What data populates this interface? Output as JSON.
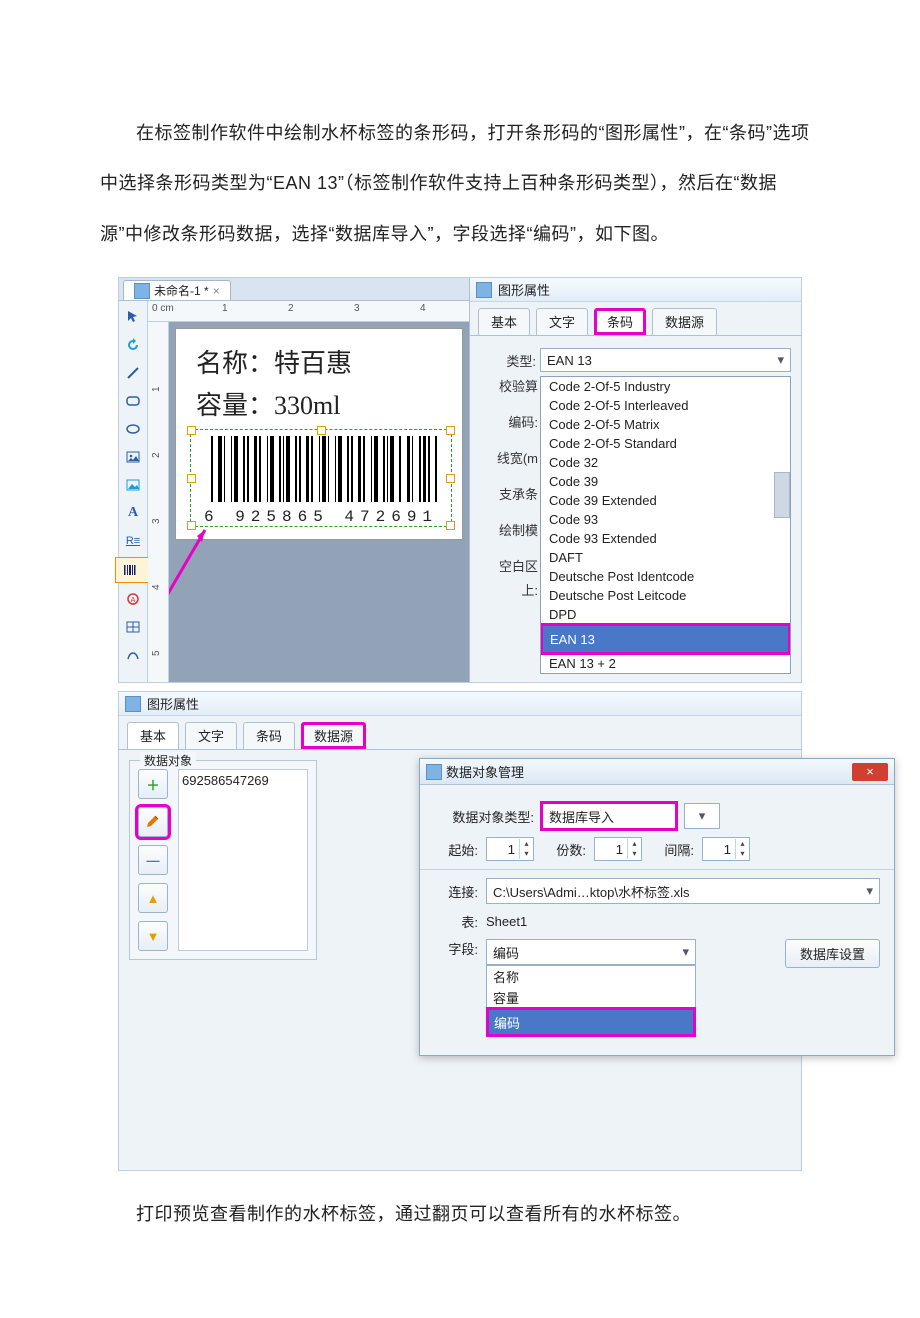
{
  "doc": {
    "para1": "在标签制作软件中绘制水杯标签的条形码，打开条形码的“图形属性”，在“条码”选项中选择条形码类型为“EAN 13”（标签制作软件支持上百种条形码类型），然后在“数据源”中修改条形码数据，选择“数据库导入”，字段选择“编码”，如下图。",
    "para2": "打印预览查看制作的水杯标签，通过翻页可以查看所有的水杯标签。"
  },
  "editor": {
    "doc_tab": "未命名-1 *",
    "ruler_unit": "0 cm",
    "ruler_marks": [
      "1",
      "2",
      "3",
      "4"
    ],
    "vruler_marks": [
      "1",
      "2",
      "3",
      "4",
      "5"
    ],
    "label": {
      "name_label": "名称：",
      "name_value": "特百惠",
      "cap_label": "容量：",
      "cap_value": "330ml",
      "barcode_lead": "6",
      "barcode_left": "925865",
      "barcode_right": "472691"
    }
  },
  "props": {
    "title": "图形属性",
    "tabs": {
      "basic": "基本",
      "text": "文字",
      "barcode": "条码",
      "datasource": "数据源"
    },
    "labels": {
      "type": "类型:",
      "check": "校验算",
      "encode": "编码:",
      "linew": "线宽(m",
      "bearer": "支承条",
      "drawmode": "绘制模",
      "blank": "空白区",
      "top": "上:"
    },
    "type_value": "EAN 13",
    "list": [
      "Code 2-Of-5 Industry",
      "Code 2-Of-5 Interleaved",
      "Code 2-Of-5 Matrix",
      "Code 2-Of-5 Standard",
      "Code 32",
      "Code 39",
      "Code 39 Extended",
      "Code 93",
      "Code 93 Extended",
      "DAFT",
      "Deutsche Post Identcode",
      "Deutsche Post Leitcode",
      "DPD",
      "EAN 13",
      "EAN 13 + 2"
    ],
    "selected_index": 13
  },
  "props2": {
    "title": "图形属性",
    "tabs": {
      "basic": "基本",
      "text": "文字",
      "barcode": "条码",
      "datasource": "数据源"
    },
    "fieldset_legend": "数据对象",
    "data_value": "692586547269"
  },
  "dlg": {
    "title": "数据对象管理",
    "type_label": "数据对象类型:",
    "type_value": "数据库导入",
    "start_label": "起始:",
    "start_value": "1",
    "copies_label": "份数:",
    "copies_value": "1",
    "gap_label": "间隔:",
    "gap_value": "1",
    "conn_label": "连接:",
    "conn_value": "C:\\Users\\Admi…ktop\\水杯标签.xls",
    "table_label": "表:",
    "table_value": "Sheet1",
    "field_label": "字段:",
    "field_value": "编码",
    "field_options": [
      "名称",
      "容量",
      "编码"
    ],
    "db_btn": "数据库设置"
  }
}
